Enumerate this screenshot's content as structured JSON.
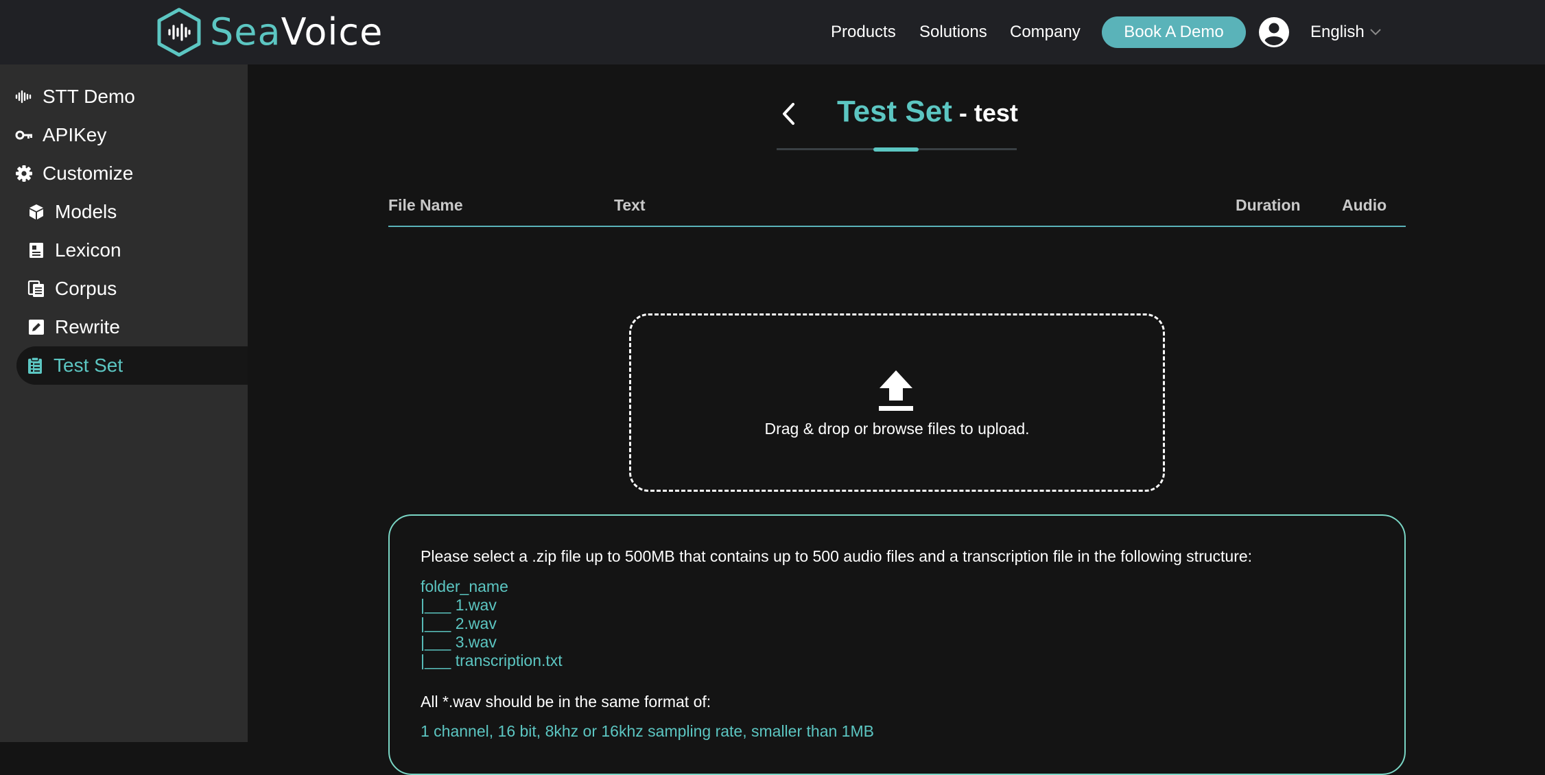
{
  "header": {
    "logo_sea": "Sea",
    "logo_voice": "Voice",
    "nav": [
      "Products",
      "Solutions",
      "Company"
    ],
    "demo_button": "Book A Demo",
    "language": "English"
  },
  "sidebar": {
    "items": [
      {
        "label": "STT Demo",
        "icon": "waveform-icon"
      },
      {
        "label": "APIKey",
        "icon": "key-icon"
      },
      {
        "label": "Customize",
        "icon": "gear-icon"
      },
      {
        "label": "Models",
        "icon": "cube-icon"
      },
      {
        "label": "Lexicon",
        "icon": "book-icon"
      },
      {
        "label": "Corpus",
        "icon": "documents-icon"
      },
      {
        "label": "Rewrite",
        "icon": "edit-icon"
      },
      {
        "label": "Test Set",
        "icon": "clipboard-icon",
        "active": true
      }
    ]
  },
  "main": {
    "title": "Test Set",
    "subtitle": "- test",
    "columns": [
      "File Name",
      "Text",
      "Duration",
      "Audio"
    ],
    "dropzone_text": "Drag & drop or browse files to upload.",
    "info": {
      "intro": "Please select a .zip file up to 500MB that contains up to 500 audio files and a transcription file in the following structure:",
      "tree": [
        "folder_name",
        "|___ 1.wav",
        "|___ 2.wav",
        "|___ 3.wav",
        "|___ transcription.txt"
      ],
      "format_label": "All *.wav should be in the same format of:",
      "format_value": "1 channel, 16 bit, 8khz or 16khz sampling rate, smaller than 1MB"
    }
  },
  "colors": {
    "accent": "#5cc6c2",
    "button": "#5ab3b9",
    "header_bg": "#202125",
    "sidebar_bg": "#2d2d2d",
    "page_bg": "#141414"
  }
}
